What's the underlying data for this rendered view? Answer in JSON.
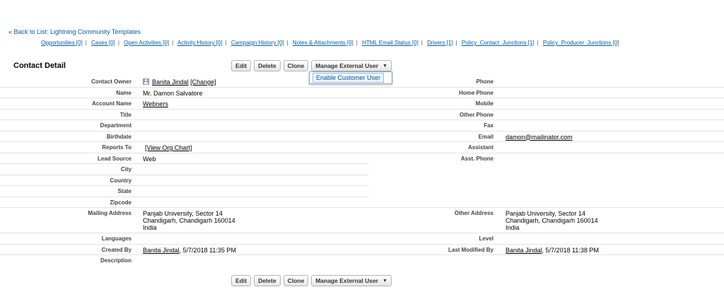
{
  "back_link": "« Back to List: Lightning Community Templates",
  "related_links": [
    "Opportunities [0]",
    "Cases [0]",
    "Open Activities [0]",
    "Activity History [0]",
    "Campaign History [0]",
    "Notes & Attachments [0]",
    "HTML Email Status [0]",
    "Drivers [1]",
    "Policy_Contact_Junctions [1]",
    "Policy_Producer_Junctions [0]"
  ],
  "related_separator": "|",
  "section_title": "Contact Detail",
  "buttons": {
    "edit": "Edit",
    "delete": "Delete",
    "clone": "Clone",
    "manage": "Manage External User",
    "caret": "▼"
  },
  "dropdown": {
    "item": "Enable Customer User"
  },
  "icons": {
    "owner": "user-avatar-icon",
    "caret": "caret-down-icon"
  },
  "fields": {
    "contact_owner": {
      "label": "Contact Owner",
      "name": "Banita Jindal",
      "change": "[Change]"
    },
    "phone": {
      "label": "Phone",
      "value": ""
    },
    "name": {
      "label": "Name",
      "value": "Mr. Damon Salvatore"
    },
    "home_phone": {
      "label": "Home Phone",
      "value": ""
    },
    "account_name": {
      "label": "Account Name",
      "value": "Webners"
    },
    "mobile": {
      "label": "Mobile",
      "value": ""
    },
    "title": {
      "label": "Title",
      "value": ""
    },
    "other_phone": {
      "label": "Other Phone",
      "value": ""
    },
    "department": {
      "label": "Department",
      "value": ""
    },
    "fax": {
      "label": "Fax",
      "value": ""
    },
    "birthdate": {
      "label": "Birthdate",
      "value": ""
    },
    "email": {
      "label": "Email",
      "value": "damon@mailinator.com"
    },
    "reports_to": {
      "label": "Reports To",
      "value": "[View Org Chart]"
    },
    "assistant": {
      "label": "Assistant",
      "value": ""
    },
    "lead_source": {
      "label": "Lead Source",
      "value": "Web"
    },
    "asst_phone": {
      "label": "Asst. Phone",
      "value": ""
    },
    "city": {
      "label": "City",
      "value": ""
    },
    "country": {
      "label": "Country",
      "value": ""
    },
    "state": {
      "label": "State",
      "value": ""
    },
    "zipcode": {
      "label": "Zipcode",
      "value": ""
    },
    "mailing_address": {
      "label": "Mailing Address",
      "line1": "Panjab University, Sector 14",
      "line2": "Chandigarh, Chandigarh 160014",
      "line3": "India"
    },
    "other_address": {
      "label": "Other Address",
      "line1": "Panjab University, Sector 14",
      "line2": "Chandigarh, Chandigarh 160014",
      "line3": "India"
    },
    "languages": {
      "label": "Languages",
      "value": ""
    },
    "level": {
      "label": "Level",
      "value": ""
    },
    "created_by": {
      "label": "Created By",
      "user": "Banita Jindal",
      "date": ", 5/7/2018 11:35 PM"
    },
    "last_modified_by": {
      "label": "Last Modified By",
      "user": "Banita Jindal",
      "date": ", 5/7/2018 11:38 PM"
    },
    "description": {
      "label": "Description",
      "value": ""
    }
  }
}
